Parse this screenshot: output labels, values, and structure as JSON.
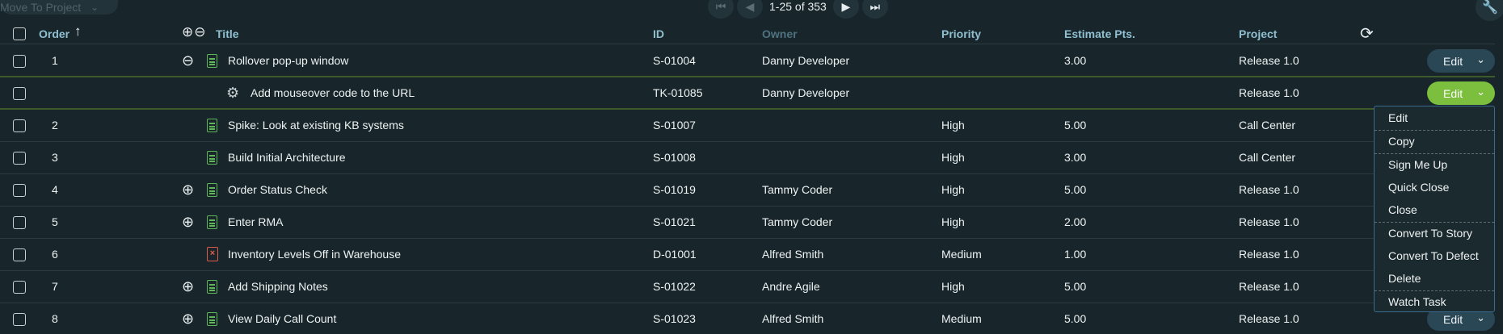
{
  "toolbar": {
    "move_label": "Move To Project",
    "page_count": "1-25 of 353"
  },
  "columns": {
    "order": "Order",
    "title": "Title",
    "id": "ID",
    "owner": "Owner",
    "priority": "Priority",
    "estimate": "Estimate Pts.",
    "project": "Project"
  },
  "rows": [
    {
      "order": "1",
      "title": "Rollover pop-up window",
      "id": "S-01004",
      "owner": "Danny Developer",
      "priority": "",
      "estimate": "3.00",
      "project": "Release 1.0",
      "edit": "Edit"
    },
    {
      "order": "",
      "title": "Add mouseover code to the URL",
      "id": "TK-01085",
      "owner": "Danny Developer",
      "priority": "",
      "estimate": "",
      "project": "Release 1.0",
      "edit": "Edit"
    },
    {
      "order": "2",
      "title": "Spike: Look at existing KB systems",
      "id": "S-01007",
      "owner": "",
      "priority": "High",
      "estimate": "5.00",
      "project": "Call Center",
      "edit": ""
    },
    {
      "order": "3",
      "title": "Build Initial Architecture",
      "id": "S-01008",
      "owner": "",
      "priority": "High",
      "estimate": "3.00",
      "project": "Call Center",
      "edit": ""
    },
    {
      "order": "4",
      "title": "Order Status Check",
      "id": "S-01019",
      "owner": "Tammy Coder",
      "priority": "High",
      "estimate": "5.00",
      "project": "Release 1.0",
      "edit": ""
    },
    {
      "order": "5",
      "title": "Enter RMA",
      "id": "S-01021",
      "owner": "Tammy Coder",
      "priority": "High",
      "estimate": "2.00",
      "project": "Release 1.0",
      "edit": ""
    },
    {
      "order": "6",
      "title": "Inventory Levels Off in Warehouse",
      "id": "D-01001",
      "owner": "Alfred Smith",
      "priority": "Medium",
      "estimate": "1.00",
      "project": "Release 1.0",
      "edit": ""
    },
    {
      "order": "7",
      "title": "Add Shipping Notes",
      "id": "S-01022",
      "owner": "Andre Agile",
      "priority": "High",
      "estimate": "5.00",
      "project": "Release 1.0",
      "edit": ""
    },
    {
      "order": "8",
      "title": "View Daily Call Count",
      "id": "S-01023",
      "owner": "Alfred Smith",
      "priority": "Medium",
      "estimate": "5.00",
      "project": "Release 1.0",
      "edit": "Edit"
    }
  ],
  "menu": {
    "edit": "Edit",
    "copy": "Copy",
    "sign_me_up": "Sign Me Up",
    "quick_close": "Quick Close",
    "close": "Close",
    "convert_story": "Convert To Story",
    "convert_defect": "Convert To Defect",
    "delete": "Delete",
    "watch_task": "Watch Task"
  },
  "icons": {
    "story": "story-icon",
    "task": "task-gear-icon",
    "defect": "defect-icon"
  },
  "colors": {
    "background": "#18262b",
    "accent_green": "#7cbf3e",
    "edit_button": "#2a4756",
    "header_text": "#8fbfd0",
    "story_icon": "#5fb75a",
    "defect_icon": "#e05a4b"
  }
}
